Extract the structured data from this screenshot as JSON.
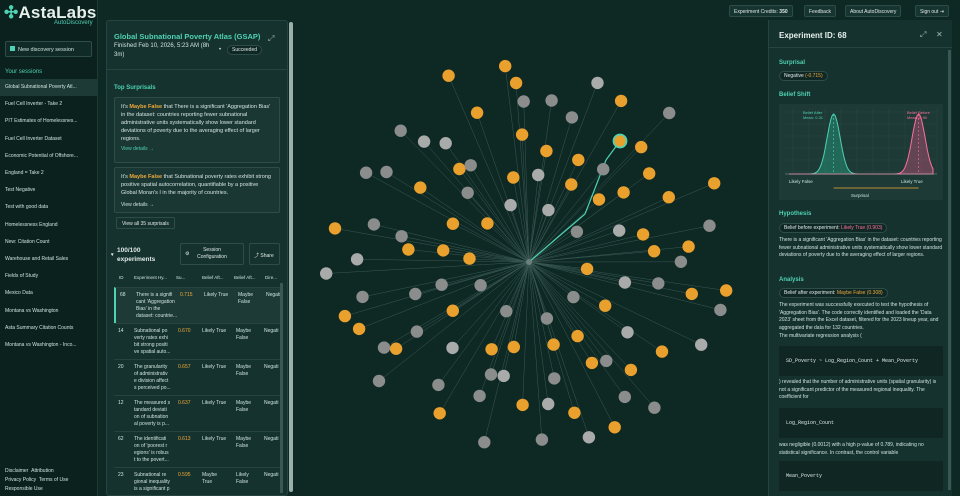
{
  "brand": {
    "name": "AstaLabs",
    "sub": "AutoDiscovery"
  },
  "sidebar": {
    "new_session": "New discovery session",
    "sessions_heading": "Your sessions",
    "sessions": [
      "Global Subnational Poverty Atl...",
      "Fuel Cell Inverter - Take 2",
      "PIT Estimates of Homelessnes...",
      "Fuel Cell Inverter Dataset",
      "Economic Potential of Offshore...",
      "England = Take 2",
      "Test Negative",
      "Test with good data",
      "Homelessness England",
      "New: Citation Count",
      "Warehouse and Retail Sales",
      "Fields of Study",
      "Mexico Data",
      "Montana vs Washington",
      "Asta Summary Citation Counts",
      "Montana vs Washington - Inco..."
    ],
    "footer": {
      "disclaimer": "Disclaimer",
      "attribution": "Attribution",
      "privacy": "Privacy Policy",
      "terms": "Terms of Use",
      "responsible": "Responsible Use"
    }
  },
  "topbar": {
    "credits_label": "Experiment Credits:",
    "credits_value": "350",
    "feedback": "Feedback",
    "about": "About AutoDiscovery",
    "signout": "Sign out"
  },
  "session": {
    "title": "Global Subnational Poverty Atlas (GSAP)",
    "finished_line1": "Finished Feb 10, 2026, 5:23 AM (8h",
    "finished_line2": "3m)",
    "dot": "•",
    "status": "Succeeded"
  },
  "surprises": {
    "heading": "Top Surprisals",
    "items": [
      {
        "prefix": "It's ",
        "verdict": "Maybe False",
        "text": " that There is a significant 'Aggregation Bias' in the dataset: countries reporting fewer subnational administrative units systematically show lower standard deviations of poverty due to the averaging effect of larger regions.",
        "link": "View details"
      },
      {
        "prefix": "It's ",
        "verdict": "Maybe False",
        "text": " that Subnational poverty rates exhibit strong positive spatial autocorrelation, quantifiable by a positive Global Moran's I in the majority of countries.",
        "link": "View details"
      }
    ],
    "view_all": "View all 35 surprisals"
  },
  "experiments": {
    "count_line1": "100/100",
    "count_line2": "experiments",
    "session_config_line1": "Session",
    "session_config_line2": "Configuration",
    "share": "Share",
    "columns": [
      "ID",
      "Experiment Hy...",
      "Su...",
      "Belief Aft...",
      "Belief Aft...",
      "Dire..."
    ],
    "rows": [
      {
        "id": "68",
        "lines": [
          "There is a signifi",
          "cant 'Aggregation",
          "Bias' in the",
          "dataset: countrie..."
        ],
        "surprisal": "0.715",
        "before": [
          "Likely True"
        ],
        "after": [
          "Maybe",
          "False"
        ],
        "dir": "Negati"
      },
      {
        "id": "14",
        "lines": [
          "Subnational po",
          "verty rates exhi",
          "bit strong positi",
          "ve spatial auto..."
        ],
        "surprisal": "0.670",
        "before": [
          "Likely True"
        ],
        "after": [
          "Maybe",
          "False"
        ],
        "dir": "Negati"
      },
      {
        "id": "20",
        "lines": [
          "The granularity",
          "of administrativ",
          "e division affect",
          "s perceived po..."
        ],
        "surprisal": "0.657",
        "before": [
          "Likely True"
        ],
        "after": [
          "Maybe",
          "False"
        ],
        "dir": "Negati"
      },
      {
        "id": "12",
        "lines": [
          "The measured s",
          "tandard deviati",
          "on of subnation",
          "al poverty is p..."
        ],
        "surprisal": "0.637",
        "before": [
          "Likely True"
        ],
        "after": [
          "Maybe",
          "False"
        ],
        "dir": "Negati"
      },
      {
        "id": "62",
        "lines": [
          "The identificati",
          "on of 'poorest r",
          "egions' is robus",
          "t to the povert..."
        ],
        "surprisal": "0.613",
        "before": [
          "Likely True"
        ],
        "after": [
          "Maybe",
          "False"
        ],
        "dir": "Negati"
      },
      {
        "id": "23",
        "lines": [
          "Subnational re",
          "gional inequality",
          "is a significant p"
        ],
        "surprisal": "0.595",
        "before": [
          "Maybe",
          "True"
        ],
        "after": [
          "Likely",
          "False"
        ],
        "dir": "Negati"
      }
    ]
  },
  "detail": {
    "title": "Experiment ID: 68",
    "surprisal_heading": "Surprisal",
    "surprisal_pill_text": "Negative",
    "surprisal_pill_value": "(-0.715)",
    "belief_shift_heading": "Belief Shift",
    "belief_after_label": "Belief After",
    "belief_after_mean": "Mean: 0.31",
    "belief_before_label": "Belief Before",
    "belief_before_mean": "Mean: 0.90",
    "axis_left": "Likely False",
    "axis_right": "Likely True",
    "axis_mid": "Surprisal",
    "chart_data": {
      "type": "area",
      "series": [
        {
          "name": "Belief After",
          "mean": 0.31
        },
        {
          "name": "Belief Before",
          "mean": 0.9
        }
      ]
    },
    "hypothesis_heading": "Hypothesis",
    "belief_before_pill": "Belief before experiment:",
    "belief_before_pill_val": "Likely True (0.903)",
    "hypothesis_text": "There is a significant 'Aggregation Bias' in the dataset: countries reporting fewer subnational administrative units systematically show lower standard deviations of poverty due to the averaging effect of larger regions.",
    "analysis_heading": "Analysis",
    "belief_after_pill": "Belief after experiment:",
    "belief_after_pill_val": "Maybe False (0.308)",
    "analysis_text": "The experiment was successfully executed to test the hypothesis of 'Aggregation Bias'. The code correctly identified and loaded the 'Data 2023' sheet from the Excel dataset, filtered for the 2023 lineup year, and aggregated the data for 132 countries.",
    "analysis_text2": "The multivariate regression analysis (",
    "code1": "SD_Poverty ~ Log_Region_Count + Mean_Poverty",
    "analysis_text3": ") revealed that the number of administrative units (spatial granularity) is not a significant predictor of the measured regional inequality. The coefficient for",
    "code2": "Log_Region_Count",
    "analysis_text4": "was negligible (0.0012) with a high p-value of 0.789, indicating no statistical significance. In contrast, the control variable",
    "code3": "Mean_Poverty"
  }
}
